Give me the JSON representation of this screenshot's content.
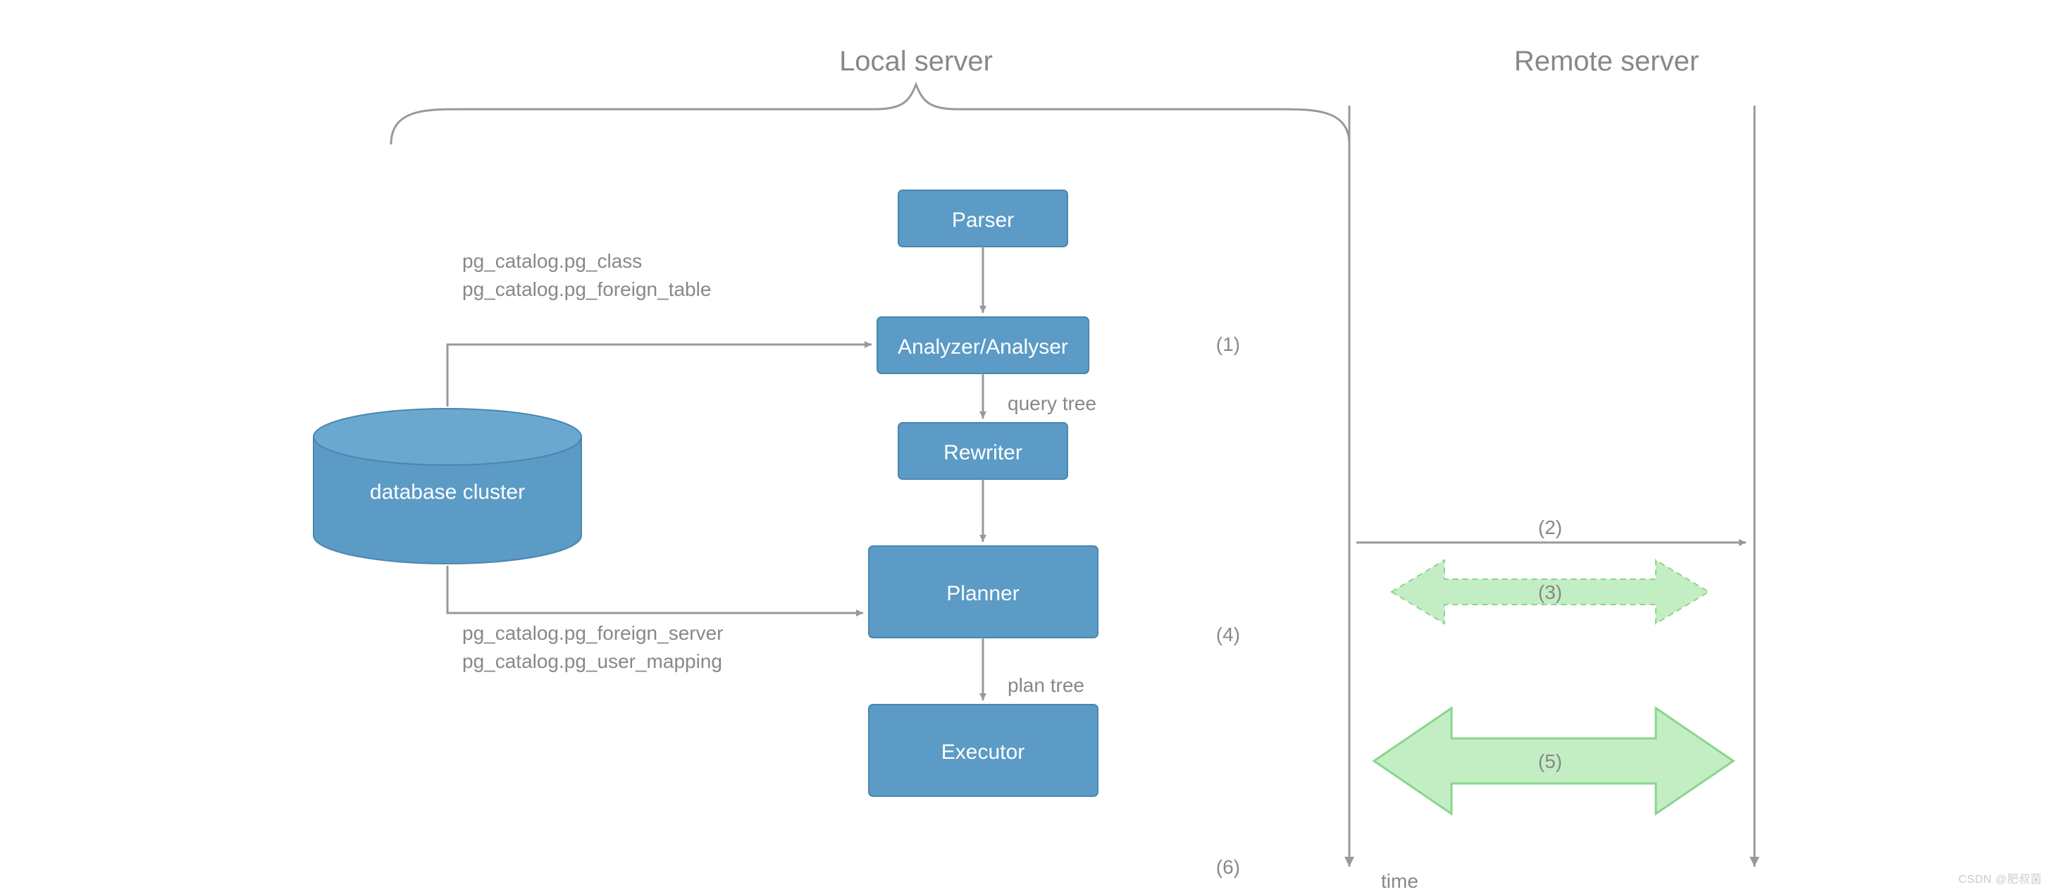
{
  "headings": {
    "local": "Local server",
    "remote": "Remote server"
  },
  "boxes": {
    "parser": "Parser",
    "analyzer": "Analyzer/Analyser",
    "rewriter": "Rewriter",
    "planner": "Planner",
    "executor": "Executor"
  },
  "cylinder": {
    "label": "database cluster"
  },
  "edge_labels": {
    "query_tree": "query tree",
    "plan_tree": "plan tree"
  },
  "catalog_groups": {
    "analyzer": {
      "line1": "pg_catalog.pg_class",
      "line2": "pg_catalog.pg_foreign_table"
    },
    "planner": {
      "line1": "pg_catalog.pg_foreign_server",
      "line2": "pg_catalog.pg_user_mapping"
    }
  },
  "step_numbers": {
    "n1": "(1)",
    "n2": "(2)",
    "n3": "(3)",
    "n4": "(4)",
    "n5": "(5)",
    "n6": "(6)"
  },
  "axis": {
    "time": "time"
  },
  "watermark": "CSDN @肥叔菌",
  "colors": {
    "box_fill": "#5b9bc6",
    "box_stroke": "#4a86b0",
    "cyl_fill": "#5b9bc6",
    "cyl_stroke": "#4a86b0",
    "arrow": "#999999",
    "green_fill": "#c3eec4",
    "green_stroke": "#8ad58c"
  }
}
